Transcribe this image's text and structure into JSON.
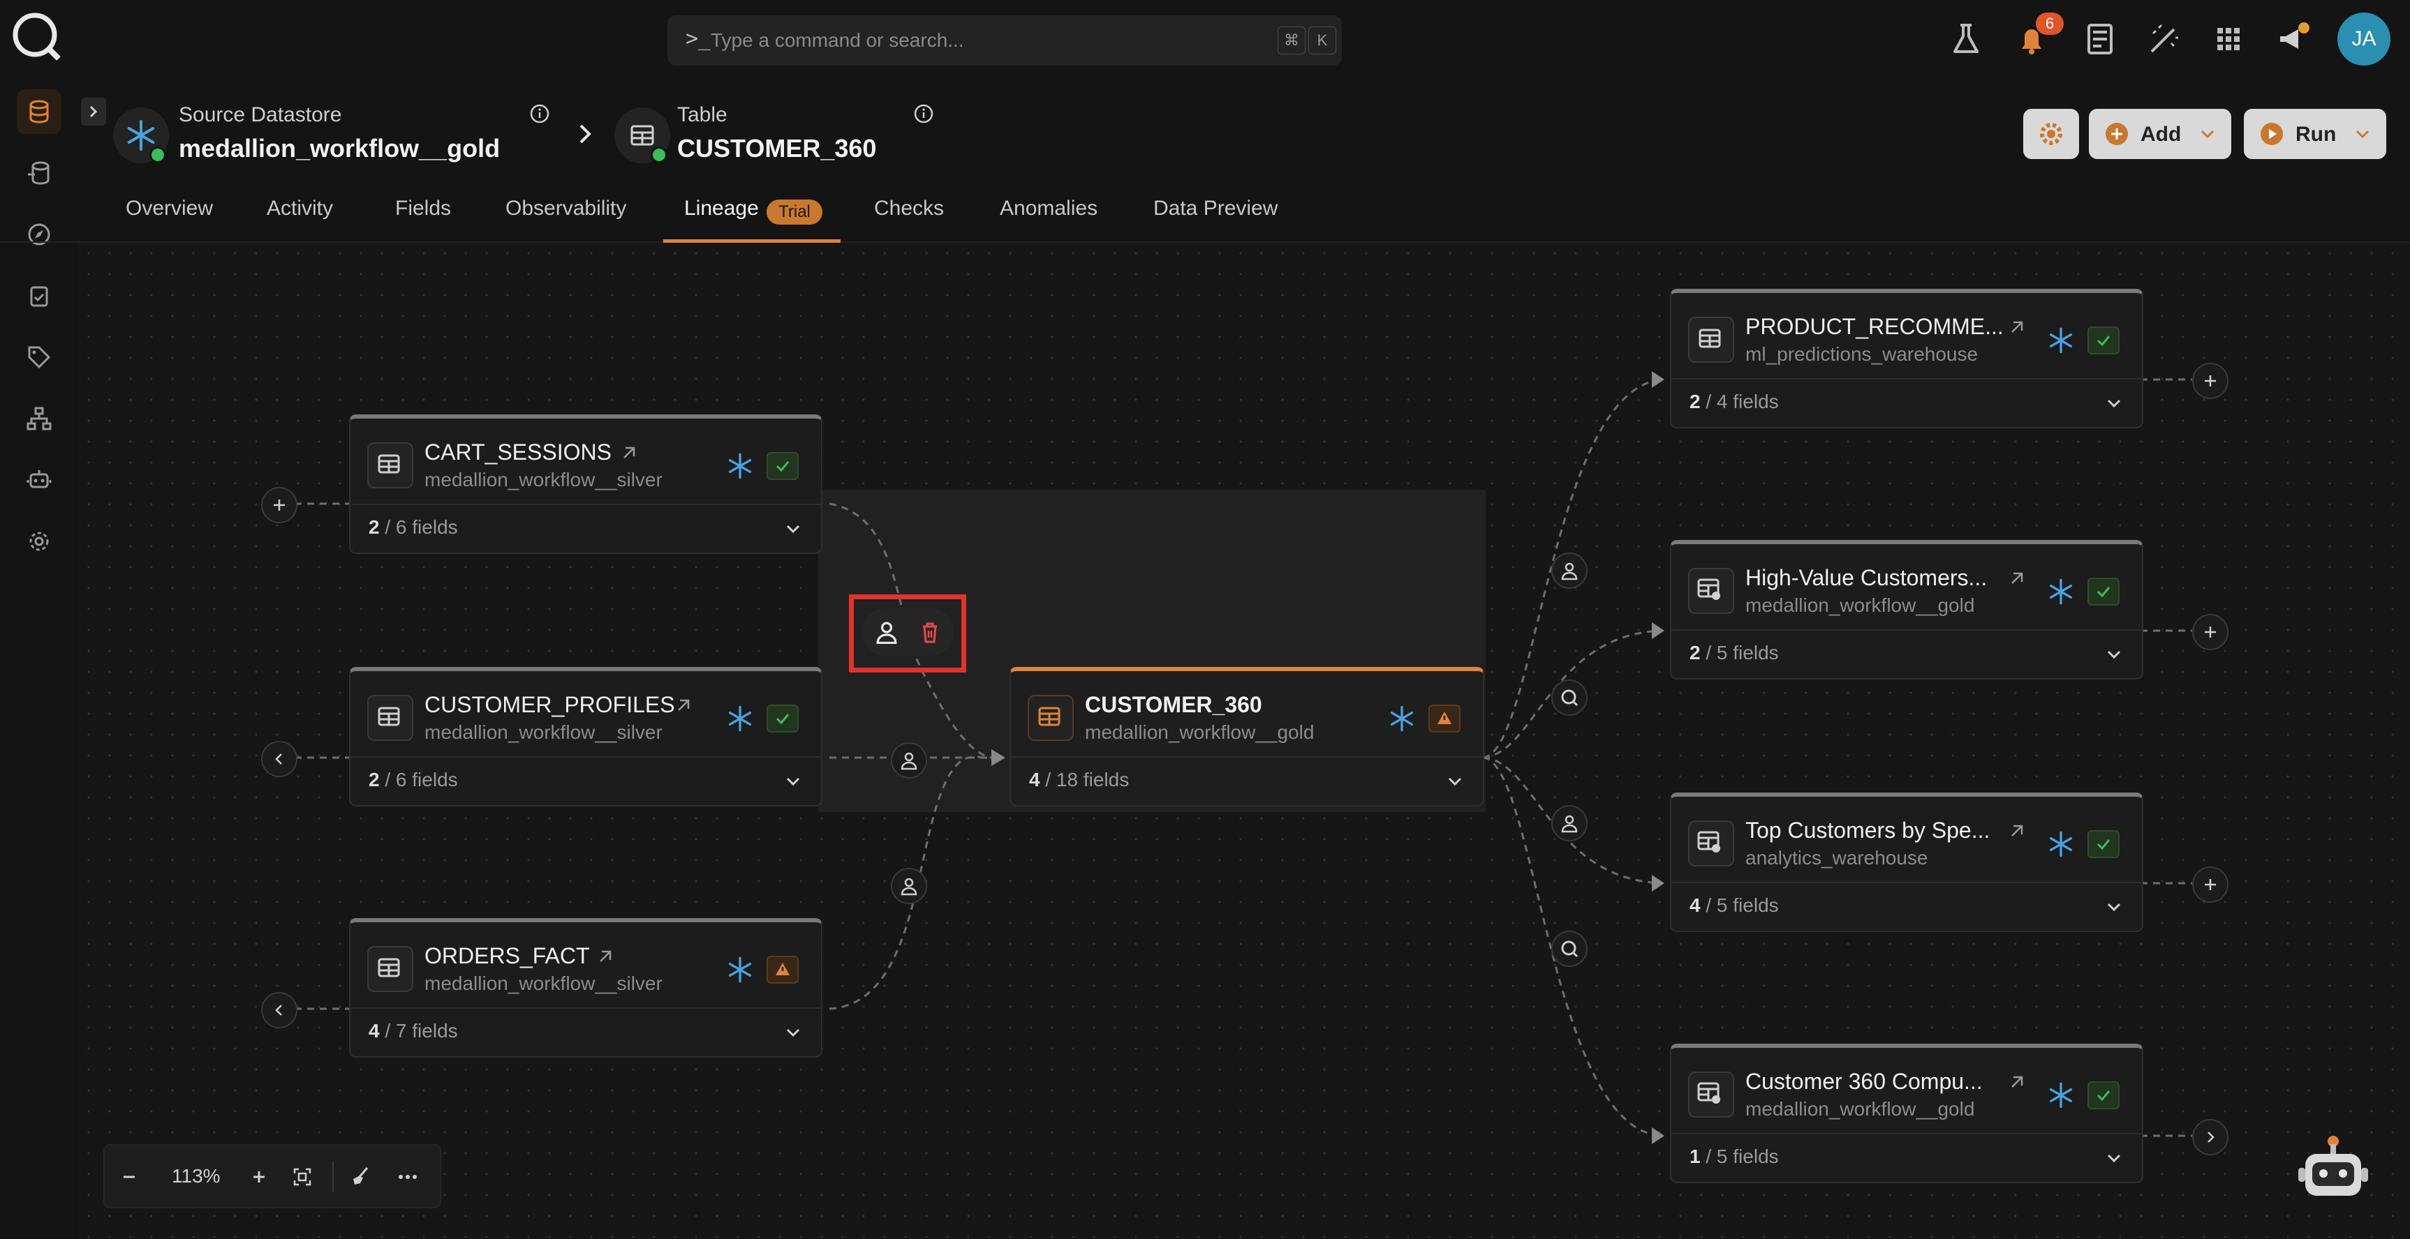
{
  "search": {
    "placeholder": "Type a command or search...",
    "shortcut_keys": [
      "⌘",
      "K"
    ]
  },
  "notifications": {
    "count": "6"
  },
  "user": {
    "initials": "JA"
  },
  "header": {
    "datastore_label": "Source Datastore",
    "datastore_name": "medallion_workflow__gold",
    "table_label": "Table",
    "table_name": "CUSTOMER_360",
    "add_label": "Add",
    "run_label": "Run"
  },
  "tabs": [
    {
      "label": "Overview"
    },
    {
      "label": "Activity"
    },
    {
      "label": "Fields"
    },
    {
      "label": "Observability"
    },
    {
      "label": "Lineage",
      "badge": "Trial",
      "active": true
    },
    {
      "label": "Checks"
    },
    {
      "label": "Anomalies"
    },
    {
      "label": "Data Preview"
    }
  ],
  "nodes": {
    "cart_sessions": {
      "name": "CART_SESSIONS",
      "datastore": "medallion_workflow__silver",
      "fields_count": "2",
      "fields_total": "/ 6 fields",
      "status": "ok"
    },
    "customer_profiles": {
      "name": "CUSTOMER_PROFILES",
      "datastore": "medallion_workflow__silver",
      "fields_count": "2",
      "fields_total": "/ 6 fields",
      "status": "ok"
    },
    "orders_fact": {
      "name": "ORDERS_FACT",
      "datastore": "medallion_workflow__silver",
      "fields_count": "4",
      "fields_total": "/ 7 fields",
      "status": "warning"
    },
    "customer_360": {
      "name": "CUSTOMER_360",
      "datastore": "medallion_workflow__gold",
      "fields_count": "4",
      "fields_total": "/ 18 fields",
      "status": "warning"
    },
    "product_recomme": {
      "name": "PRODUCT_RECOMME...",
      "datastore": "ml_predictions_warehouse",
      "fields_count": "2",
      "fields_total": "/ 4 fields",
      "status": "ok"
    },
    "high_value": {
      "name": "High-Value Customers...",
      "datastore": "medallion_workflow__gold",
      "fields_count": "2",
      "fields_total": "/ 5 fields",
      "status": "ok"
    },
    "top_customers": {
      "name": "Top Customers by Spe...",
      "datastore": "analytics_warehouse",
      "fields_count": "4",
      "fields_total": "/ 5 fields",
      "status": "ok"
    },
    "customer_360_compu": {
      "name": "Customer 360 Compu...",
      "datastore": "medallion_workflow__gold",
      "fields_count": "1",
      "fields_total": "/ 5 fields",
      "status": "ok"
    }
  },
  "zoom": {
    "level": "113%"
  },
  "colors": {
    "accent": "#e0833a",
    "snowflake": "#4aa3df",
    "ok": "#3bbd5a",
    "warning": "#e0833a",
    "highlight": "#e0332a",
    "delete": "#e5484d"
  }
}
